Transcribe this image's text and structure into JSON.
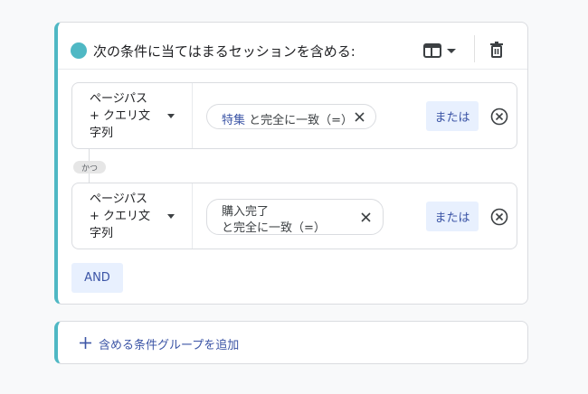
{
  "group": {
    "title": "次の条件に当てはまるセッションを含める:",
    "accent_color": "#4fb8c4",
    "scope_icon": "table-view-icon",
    "delete_icon": "trash-icon"
  },
  "conditions": [
    {
      "dimension_lines": [
        "ページパス",
        "+ クエリ文",
        "字列"
      ],
      "value": "特集",
      "match_text": "と完全に一致（=）",
      "or_label": "または"
    },
    {
      "dimension_lines": [
        "ページパス",
        "+ クエリ文",
        "字列"
      ],
      "value": "購入完了",
      "match_text": "と完全に一致（=）",
      "or_label": "または"
    }
  ],
  "and_connector": "かつ",
  "and_button": "AND",
  "add_group": {
    "label": "含める条件グループを追加"
  }
}
